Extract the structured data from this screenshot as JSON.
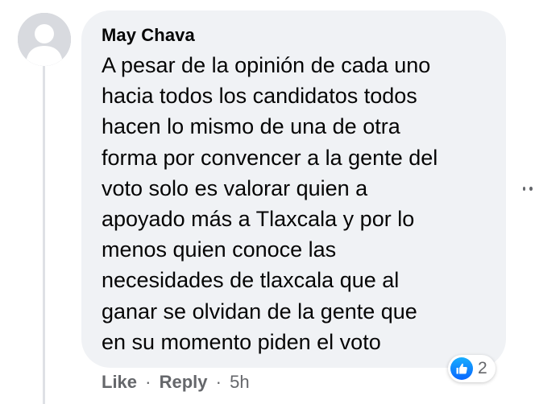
{
  "comment": {
    "author": "May Chava",
    "text_lines": [
      "A pesar de la opinión de cada uno",
      "hacia todos los candidatos todos",
      "hacen lo mismo de una de otra",
      "forma por convencer a la gente del",
      "voto solo es valorar quien a",
      "apoyado más a Tlaxcala y por lo",
      "menos quien conoce las",
      "necesidades de tlaxcala que al",
      "ganar se olvidan de la gente que",
      "en su momento piden el voto"
    ],
    "reactions": {
      "icon": "like-icon",
      "count": "2"
    },
    "actions": {
      "like_label": "Like",
      "reply_label": "Reply",
      "separator": "·",
      "timestamp": "5h"
    },
    "avatar_icon": "default-avatar-icon",
    "more_icon": "more-options-icon"
  },
  "colors": {
    "bubble_bg": "#f0f2f5",
    "text": "#050505",
    "secondary_text": "#65676b",
    "like_blue": "#0866ff"
  }
}
